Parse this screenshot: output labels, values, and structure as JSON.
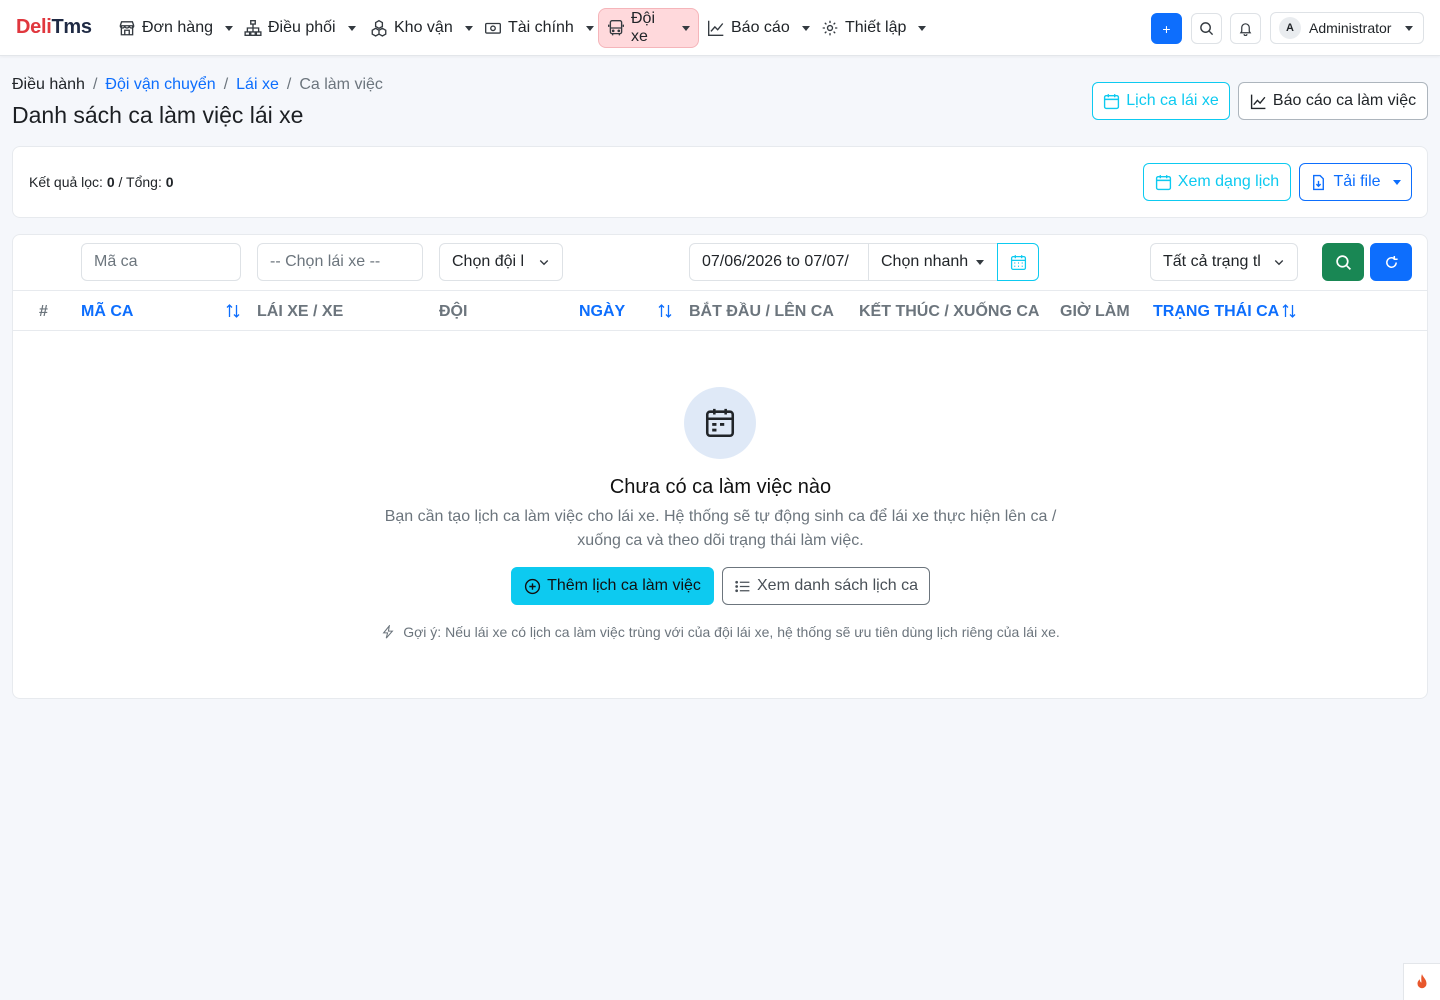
{
  "brand": {
    "part1": "Deli",
    "part2": "Tms"
  },
  "nav": {
    "items": [
      {
        "label": "Đơn hàng",
        "icon": "store-icon"
      },
      {
        "label": "Điều phối",
        "icon": "sitemap-icon"
      },
      {
        "label": "Kho vận",
        "icon": "boxes-icon"
      },
      {
        "label": "Tài chính",
        "icon": "cash-icon"
      },
      {
        "label": "Đội xe",
        "icon": "bus-icon",
        "active": true
      },
      {
        "label": "Báo cáo",
        "icon": "chart-line-icon"
      },
      {
        "label": "Thiết lập",
        "icon": "gear-icon"
      }
    ],
    "add_label": "+",
    "user": {
      "initial": "A",
      "name": "Administrator"
    }
  },
  "breadcrumb": {
    "items": [
      "Điều hành",
      "Đội vận chuyển",
      "Lái xe",
      "Ca làm việc"
    ],
    "sep": "/"
  },
  "page": {
    "title": "Danh sách ca làm việc lái xe",
    "actions": {
      "schedule": "Lịch ca lái xe",
      "report": "Báo cáo ca làm việc"
    }
  },
  "summary": {
    "filtered_label": "Kết quả lọc:",
    "filtered_value": "0",
    "total_label": "/ Tổng:",
    "total_value": "0",
    "calendar_view": "Xem dạng lịch",
    "download": "Tải file"
  },
  "filters": {
    "shift_code_placeholder": "Mã ca",
    "driver_placeholder": "-- Chọn lái xe --",
    "team_select": "Chọn đội l",
    "date_range": "07/06/2026 to 07/07/",
    "quick_select": "Chọn nhanh",
    "status_select": "Tất cả trạng tl"
  },
  "table": {
    "columns": [
      "#",
      "MÃ CA",
      "LÁI XE / XE",
      "ĐỘI",
      "NGÀY",
      "BẮT ĐẦU / LÊN CA",
      "KẾT THÚC / XUỐNG CA",
      "GIỜ LÀM",
      "TRẠNG THÁI CA"
    ]
  },
  "empty": {
    "title": "Chưa có ca làm việc nào",
    "desc": "Bạn cần tạo lịch ca làm việc cho lái xe. Hệ thống sẽ tự động sinh ca để lái xe thực hiện lên ca / xuống ca và theo dõi trạng thái làm việc.",
    "add_button": "Thêm lịch ca làm việc",
    "list_button": "Xem danh sách lịch ca",
    "hint": "Gợi ý: Nếu lái xe có lịch ca làm việc trùng với của đội lái xe, hệ thống sẽ ưu tiên dùng lịch riêng của lái xe."
  },
  "colors": {
    "primary": "#0d6efd",
    "info": "#0dcaf0",
    "success": "#198754",
    "brand_red": "#e0373e",
    "active_nav": "#ffd9dc"
  }
}
